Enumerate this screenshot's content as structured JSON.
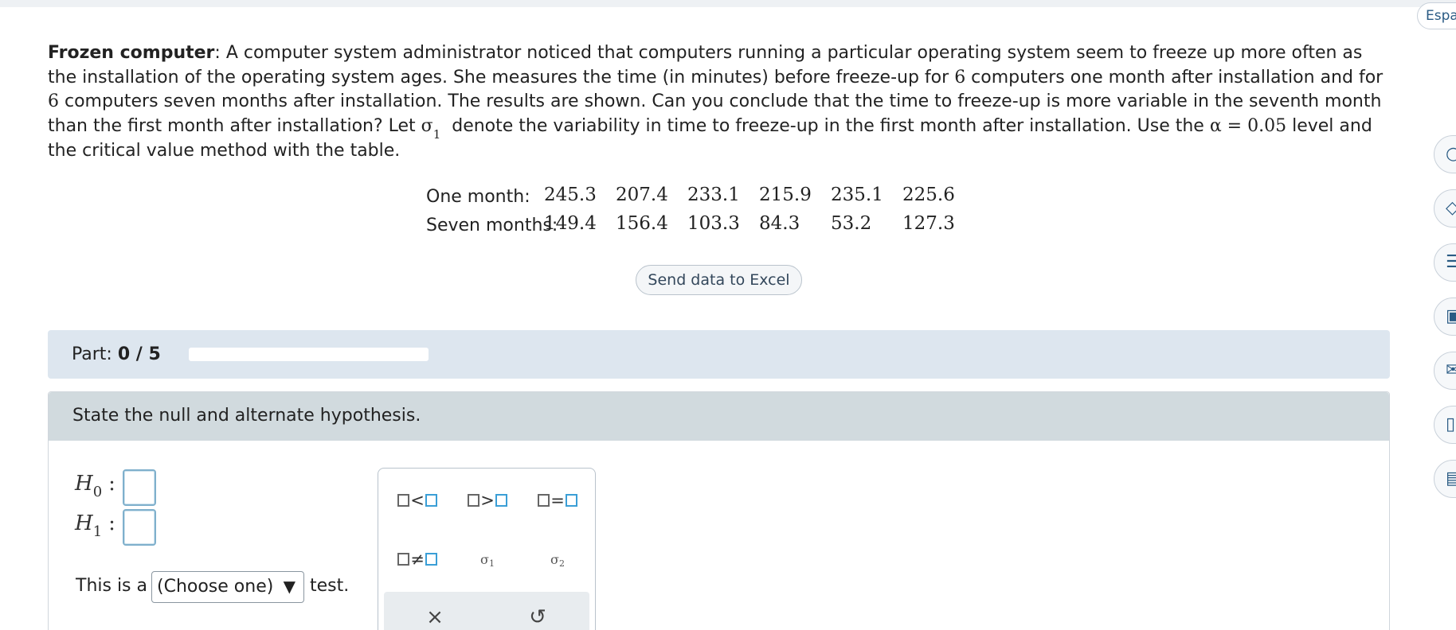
{
  "header": {
    "language_button": "Espa"
  },
  "problem": {
    "title": "Frozen computer",
    "text_1": ": A computer system administrator noticed that computers running a particular operating system seem to freeze up more often as the installation of the operating system ages. She measures the time (in minutes) before freeze-up for ",
    "n1": "6",
    "text_2": " computers one month after installation and for ",
    "n2": "6",
    "text_3": " computers seven months after installation. The results are shown. Can you conclude that the time to freeze-up is more variable in the seventh month than the first month after installation? Let ",
    "sigma_symbol": "σ",
    "sigma_sub": "1",
    "text_4": " denote the variability in time to freeze-up in the first month after installation. Use the ",
    "alpha_expr": "α = 0.05",
    "text_5": " level and the critical value method with the table."
  },
  "data_table": {
    "rows": [
      {
        "label": "One month:",
        "values": [
          "245.3",
          "207.4",
          "233.1",
          "215.9",
          "235.1",
          "225.6"
        ]
      },
      {
        "label": "Seven months:",
        "values": [
          "149.4",
          "156.4",
          "103.3",
          "84.3",
          "53.2",
          "127.3"
        ]
      }
    ]
  },
  "excel_button": "Send data to Excel",
  "part": {
    "label": "Part:",
    "value": "0 / 5",
    "progress_fraction": 0
  },
  "question": {
    "prompt": "State the null and alternate hypothesis.",
    "h0_symbol": "H",
    "h0_sub": "0",
    "h1_symbol": "H",
    "h1_sub": "1",
    "colon": ":",
    "test_before": "This is a",
    "test_select_value": "(Choose one)",
    "test_caret": "▼",
    "test_after": "test."
  },
  "palette": {
    "less_than": "<",
    "greater_than": ">",
    "equals": "=",
    "not_equal": "≠",
    "sigma1_symbol": "σ",
    "sigma1_sub": "1",
    "sigma2_symbol": "σ",
    "sigma2_sub": "2",
    "clear_icon": "×",
    "undo_icon": "↺"
  },
  "side_icons": [
    "search-icon",
    "diamond-icon",
    "list-icon",
    "book-icon",
    "mail-icon",
    "chart-icon",
    "calculator-icon"
  ],
  "side_icon_glyphs": [
    "○",
    "◇",
    "☰",
    "▣",
    "✉",
    "▯",
    "▤"
  ]
}
